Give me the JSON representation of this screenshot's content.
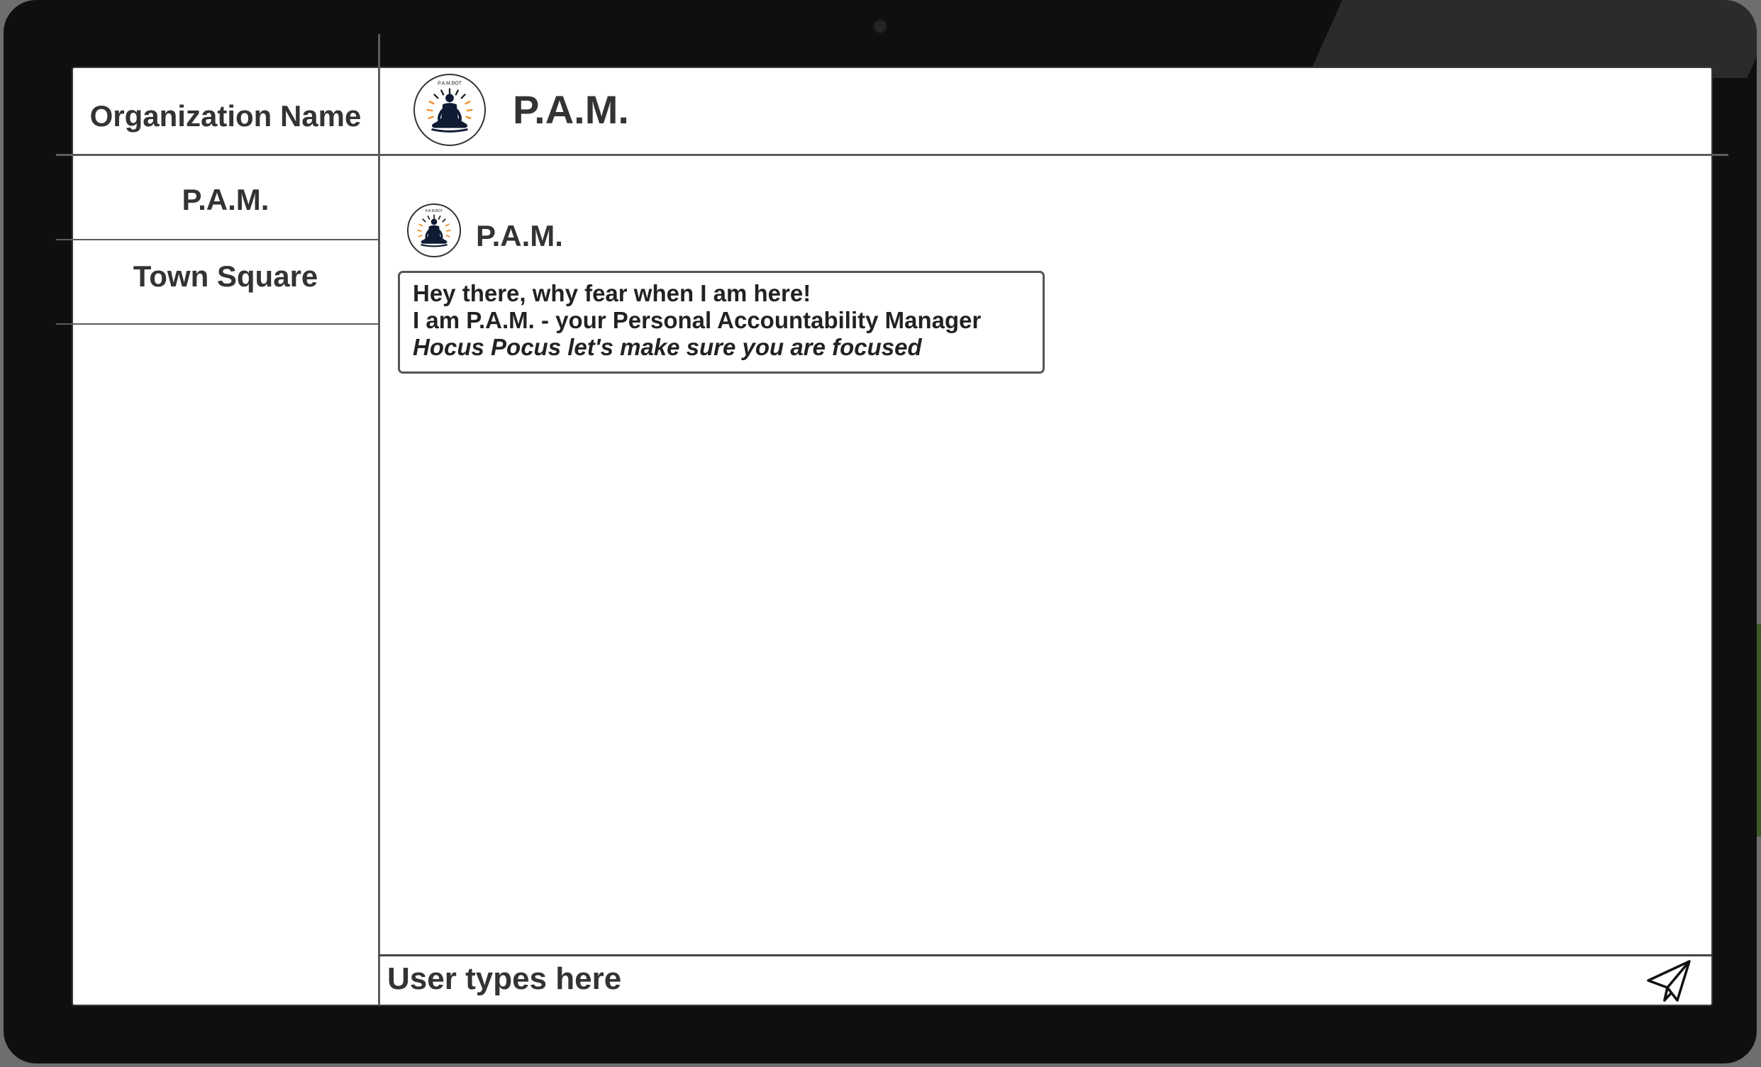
{
  "sidebar": {
    "org_name": "Organization Name",
    "items": [
      {
        "label": "P.A.M."
      },
      {
        "label": "Town Square"
      }
    ]
  },
  "header": {
    "title": "P.A.M.",
    "logo_icon": "meditation-logo-icon",
    "logo_text": "P.A.M.BOT"
  },
  "messages": [
    {
      "sender": "P.A.M.",
      "avatar_icon": "meditation-logo-icon",
      "lines": [
        "Hey there, why fear when I am here!",
        "I am P.A.M. - your Personal Accountability Manager",
        "Hocus Pocus let's make sure you are focused"
      ]
    }
  ],
  "composer": {
    "placeholder": "User types here",
    "send_icon": "paper-plane-icon"
  },
  "colors": {
    "accent_orange": "#f08a24",
    "figure_navy": "#0f1b33",
    "text_dark": "#333333"
  }
}
